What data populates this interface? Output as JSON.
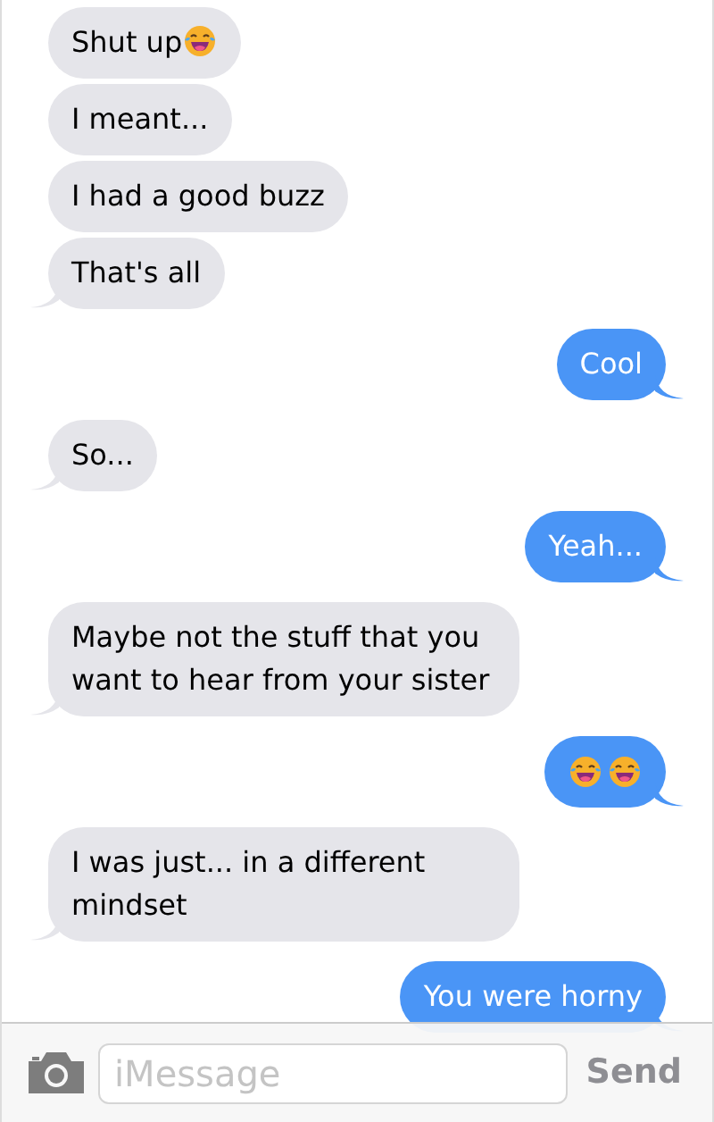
{
  "groups": [
    {
      "kind": "received",
      "messages": [
        {
          "parts": [
            {
              "kind": "text",
              "text": "Shut up"
            },
            {
              "kind": "emoji"
            }
          ]
        },
        {
          "parts": [
            {
              "kind": "text",
              "text": "I meant..."
            }
          ]
        },
        {
          "parts": [
            {
              "kind": "text",
              "text": "I had a good buzz"
            }
          ]
        },
        {
          "parts": [
            {
              "kind": "text",
              "text": "That's all"
            }
          ]
        }
      ]
    },
    {
      "kind": "sent",
      "messages": [
        {
          "parts": [
            {
              "kind": "text",
              "text": "Cool"
            }
          ]
        }
      ]
    },
    {
      "kind": "received",
      "messages": [
        {
          "parts": [
            {
              "kind": "text",
              "text": "So..."
            }
          ]
        }
      ]
    },
    {
      "kind": "sent",
      "messages": [
        {
          "parts": [
            {
              "kind": "text",
              "text": "Yeah..."
            }
          ]
        }
      ]
    },
    {
      "kind": "received",
      "messages": [
        {
          "parts": [
            {
              "kind": "text",
              "text": "Maybe not the stuff that you want to hear from your sister"
            }
          ]
        }
      ]
    },
    {
      "kind": "sent",
      "messages": [
        {
          "parts": [
            {
              "kind": "emoji"
            },
            {
              "kind": "emoji"
            }
          ]
        }
      ]
    },
    {
      "kind": "received",
      "messages": [
        {
          "parts": [
            {
              "kind": "text",
              "text": "I was just... in a different mindset"
            }
          ]
        }
      ]
    },
    {
      "kind": "sent",
      "messages": [
        {
          "parts": [
            {
              "kind": "text",
              "text": "You were horny"
            }
          ]
        }
      ]
    }
  ],
  "composer": {
    "placeholder": "iMessage",
    "send": "Send"
  }
}
